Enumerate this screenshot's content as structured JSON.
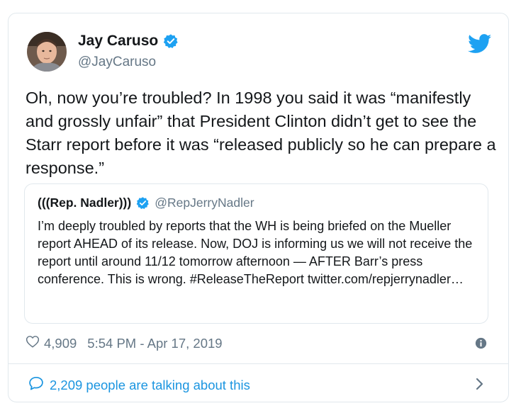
{
  "tweet": {
    "author": {
      "name": "Jay Caruso",
      "handle": "@JayCaruso",
      "avatar_icon": "avatar"
    },
    "text": "Oh, now you’re troubled? In 1998 you said it was “manifestly and grossly unfair” that President Clinton didn’t get to see the Starr report before it was “released publicly so he can prepare a response.”",
    "quoted": {
      "name": "(((Rep. Nadler)))",
      "handle": "@RepJerryNadler",
      "text": "I’m deeply troubled by reports that the WH is being briefed on the Mueller report AHEAD of its release. Now, DOJ is informing us we will not receive the report until around 11/12 tomorrow afternoon — AFTER Barr’s press conference. This is wrong. #ReleaseTheReport twitter.com/repjerrynadler…"
    },
    "likes": "4,909",
    "timestamp": "5:54 PM - Apr 17, 2019",
    "talking": "2,209 people are talking about this"
  },
  "colors": {
    "twitter_blue": "#1da1f2",
    "link_blue": "#1b95e0",
    "secondary_text": "#657786",
    "border": "#e1e8ed"
  },
  "icons": [
    "avatar",
    "verified-badge-icon",
    "twitter-bird-icon",
    "heart-icon",
    "info-icon",
    "speech-bubble-icon",
    "chevron-right-icon"
  ]
}
